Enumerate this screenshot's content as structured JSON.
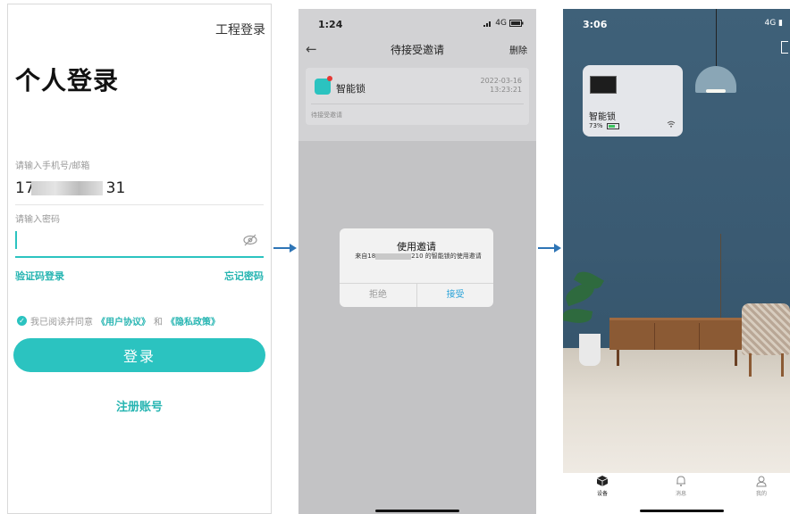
{
  "login": {
    "engineer_login": "工程登录",
    "title": "个人登录",
    "phone_label": "请输入手机号/邮箱",
    "phone_prefix": "17",
    "phone_suffix": "31",
    "password_label": "请输入密码",
    "code_login": "验证码登录",
    "forgot": "忘记密码",
    "agree_prefix": "我已阅读并同意",
    "user_agreement": "《用户协议》",
    "agree_and": "和",
    "privacy_policy": "《隐私政策》",
    "login_button": "登录",
    "register": "注册账号",
    "accent_color": "#2bc3c0"
  },
  "invites": {
    "time": "1:24",
    "network": "4G",
    "header": "待接受邀请",
    "delete": "删除",
    "card": {
      "device_name": "智能锁",
      "date": "2022-03-16",
      "clock": "13:23:21",
      "status": "待接受邀请"
    },
    "dialog": {
      "title": "使用邀请",
      "msg_prefix": "来自18",
      "msg_suffix": "210 的智能锁的使用邀请",
      "refuse": "拒绝",
      "accept": "接受"
    }
  },
  "home": {
    "time": "3:06",
    "network": "4G",
    "device": {
      "name": "智能锁",
      "battery": "73%",
      "battery_level": 0.73
    },
    "tabs": [
      {
        "label": "设备",
        "icon": "cube-icon",
        "active": true
      },
      {
        "label": "消息",
        "icon": "bell-icon",
        "active": false
      },
      {
        "label": "我的",
        "icon": "person-icon",
        "active": false
      }
    ]
  }
}
